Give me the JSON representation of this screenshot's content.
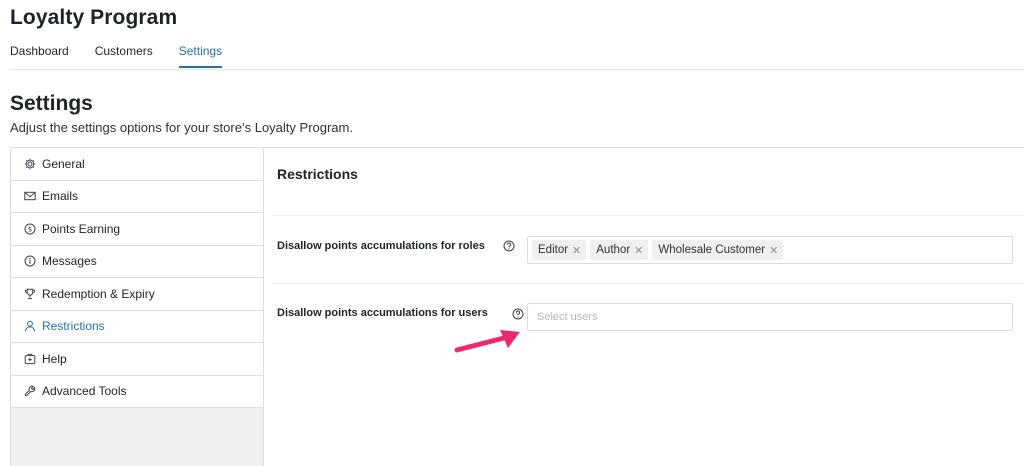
{
  "app": {
    "title": "Loyalty Program"
  },
  "nav": {
    "tabs": [
      {
        "label": "Dashboard",
        "active": false
      },
      {
        "label": "Customers",
        "active": false
      },
      {
        "label": "Settings",
        "active": true
      }
    ]
  },
  "page": {
    "heading": "Settings",
    "description": "Adjust the settings options for your store’s Loyalty Program."
  },
  "sidebar": {
    "items": [
      {
        "label": "General",
        "icon": "gear-icon"
      },
      {
        "label": "Emails",
        "icon": "envelope-icon"
      },
      {
        "label": "Points Earning",
        "icon": "dollar-circle-icon"
      },
      {
        "label": "Messages",
        "icon": "info-circle-icon"
      },
      {
        "label": "Redemption & Expiry",
        "icon": "trophy-icon"
      },
      {
        "label": "Restrictions",
        "icon": "user-icon",
        "active": true
      },
      {
        "label": "Help",
        "icon": "lifebuoy-icon"
      },
      {
        "label": "Advanced Tools",
        "icon": "wrench-icon"
      }
    ]
  },
  "restrictions": {
    "title": "Restrictions",
    "roles": {
      "label": "Disallow points accumulations for roles",
      "chips": [
        "Editor",
        "Author",
        "Wholesale Customer"
      ]
    },
    "users": {
      "label": "Disallow points accumulations for users",
      "placeholder": "Select users",
      "value": ""
    }
  },
  "colors": {
    "accent": "#2271b1",
    "annotation_arrow": "#ec2a6a"
  }
}
